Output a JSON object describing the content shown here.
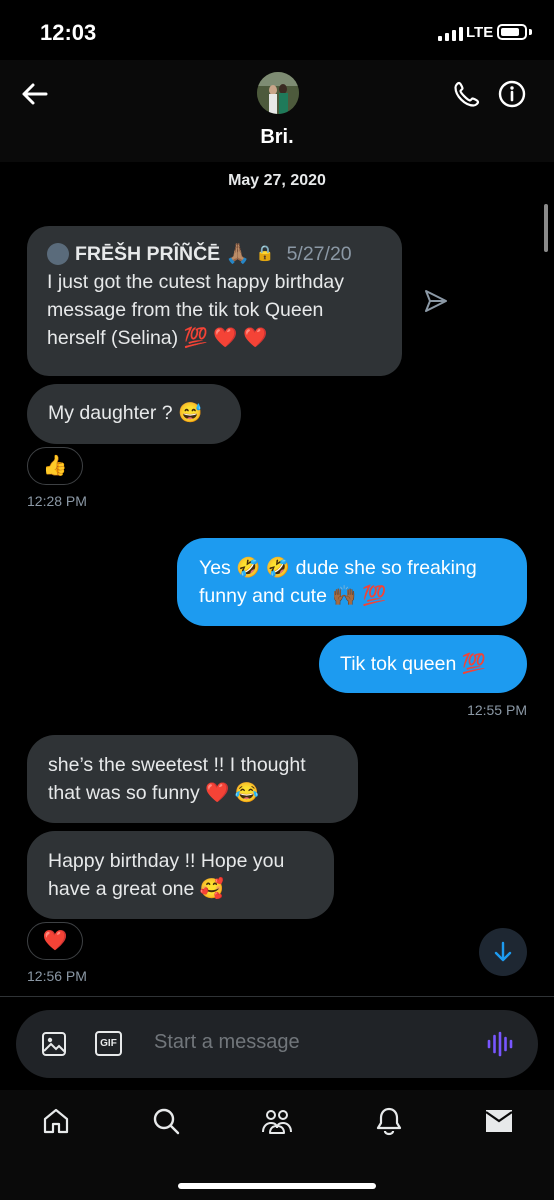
{
  "status_bar": {
    "time": "12:03",
    "network": "LTE"
  },
  "header": {
    "contact_name": "Bri."
  },
  "date_separator": "May 27, 2020",
  "messages": [
    {
      "type": "quoted",
      "author": "FRĒŠH PRÎÑČĒ 🙏🏽",
      "date": "5/27/20",
      "lines": [
        "I just got the cutest happy birthday",
        "message from the tik tok Queen",
        "herself (Selina) 💯 ❤️ ❤️"
      ]
    },
    {
      "type": "in",
      "text": "My daughter ? 😅",
      "reaction": "👍",
      "time": "12:28 PM"
    },
    {
      "type": "out",
      "lines": [
        "Yes 🤣 🤣 dude she so freaking",
        "funny and cute 🙌🏾 💯"
      ]
    },
    {
      "type": "out",
      "text": "Tik tok queen 💯",
      "time": "12:55 PM"
    },
    {
      "type": "in",
      "lines": [
        "she’s the sweetest !! I thought",
        "that was so funny ❤️ 😂"
      ]
    },
    {
      "type": "in",
      "lines": [
        "Happy birthday !! Hope you",
        "have a great one 🥰"
      ],
      "reaction": "❤️",
      "time": "12:56 PM"
    }
  ],
  "compose": {
    "placeholder": "Start a message",
    "gif_label": "GIF"
  },
  "tabs": [
    "home-icon",
    "search-icon",
    "communities-icon",
    "notifications-icon",
    "messages-icon"
  ],
  "colors": {
    "accent": "#1d9bf0",
    "incoming_bubble": "#2f3336",
    "background": "#000000"
  }
}
